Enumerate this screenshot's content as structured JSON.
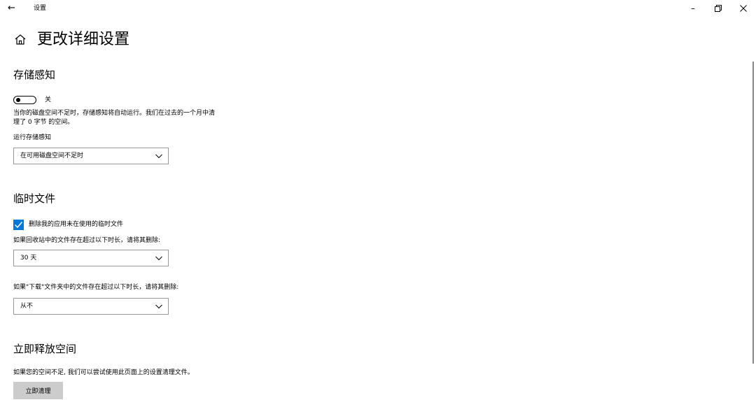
{
  "titlebar": {
    "back_icon": "arrow-left-icon",
    "title": "设置",
    "minimize_glyph": "–",
    "restore_glyph": "❐",
    "close_glyph": "✕"
  },
  "header": {
    "home_icon": "home-icon",
    "title": "更改详细设置"
  },
  "storage_sense": {
    "heading": "存储感知",
    "toggle_state": "关",
    "description_line1": "当你的磁盘空间不足时，存储感知将自动运行。我们在过去的一个月中清",
    "description_line2": "理了 0 字节 的空间。",
    "run_label": "运行存储感知",
    "run_value": "在可用磁盘空间不足时"
  },
  "temp_files": {
    "heading": "临时文件",
    "checkbox_checked": true,
    "checkbox_label": "删除我的应用未在使用的临时文件",
    "recycle_label": "如果回收站中的文件存在超过以下时长，请将其删除:",
    "recycle_value": "30 天",
    "downloads_label": "如果\"下载\"文件夹中的文件存在超过以下时长，请将其删除:",
    "downloads_value": "从不"
  },
  "free_space": {
    "heading": "立即释放空间",
    "description": "如果您的空间不足, 我们可以尝试使用此页面上的设置清理文件。",
    "button_label": "立即清理"
  },
  "colors": {
    "accent": "#0078d7",
    "button_bg": "#cccccc",
    "dropdown_border": "#999999",
    "scrollbar": "#858585"
  }
}
